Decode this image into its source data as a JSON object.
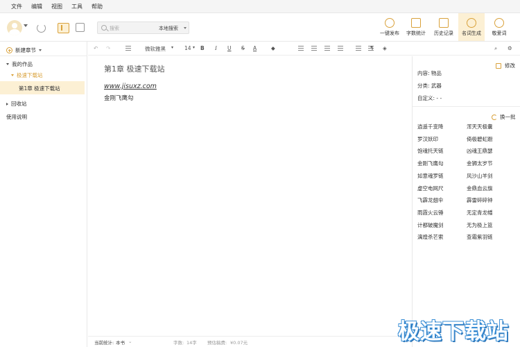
{
  "menu": [
    "文件",
    "编辑",
    "视图",
    "工具",
    "帮助"
  ],
  "search": {
    "placeholder": "搜索",
    "scope": "本地搜索"
  },
  "toolbar_buttons": [
    "一键发布",
    "字数统计",
    "历史记录",
    "名词生成",
    "敬爱词"
  ],
  "sidebar": {
    "new_chapter": "新建章节",
    "my_works": "我的作品",
    "book": "极速下载站",
    "chapter": "第1章 极速下载站",
    "recycle": "回收站",
    "help": "使用说明"
  },
  "editor_toolbar": {
    "font": "微软雅黑",
    "size": "14",
    "bold": "B",
    "italic": "I",
    "underline": "U",
    "strike": "S",
    "color": "A"
  },
  "editor": {
    "title": "第1章 极速下载站",
    "url": "www.jisuxz.com",
    "body": "金刚飞鹰勾"
  },
  "statusbar": {
    "count_label": "当前统计:",
    "count_scope": "本书",
    "words_label": "字数:",
    "words": "14字",
    "income_label": "预估稿费:",
    "income": "¥0.07元"
  },
  "right_panel": {
    "modify": "修改",
    "content_label": "内容:",
    "content_value": "物品",
    "category_label": "分类:",
    "category_value": "武器",
    "custom_label": "自定义:",
    "custom_value": "- -",
    "refresh": "换一批",
    "names_left": [
      "逍遥千变降",
      "罗汉妖印",
      "饱魂托天链",
      "金刚飞鹰勾",
      "如意魂罗链",
      "虚空电网尺",
      "飞霹龙翅伞",
      "雨霞火云锤",
      "计都破魔剑",
      "漓煌杀芒索"
    ],
    "names_right": [
      "浑天天极囊",
      "倚极碧虹蹰",
      "凶魂王鼎瑟",
      "金狮太岁节",
      "风沙山羊剑",
      "金鼎血云旗",
      "霹雷碎碎钟",
      "无定青龙幡",
      "无为极上篮",
      "查霜紫羽链"
    ]
  },
  "watermark": "极速下载站",
  "colors": {
    "accent": "#d9a13a",
    "selected_bg": "#fcf0d4",
    "watermark": "#3b8fd6"
  }
}
